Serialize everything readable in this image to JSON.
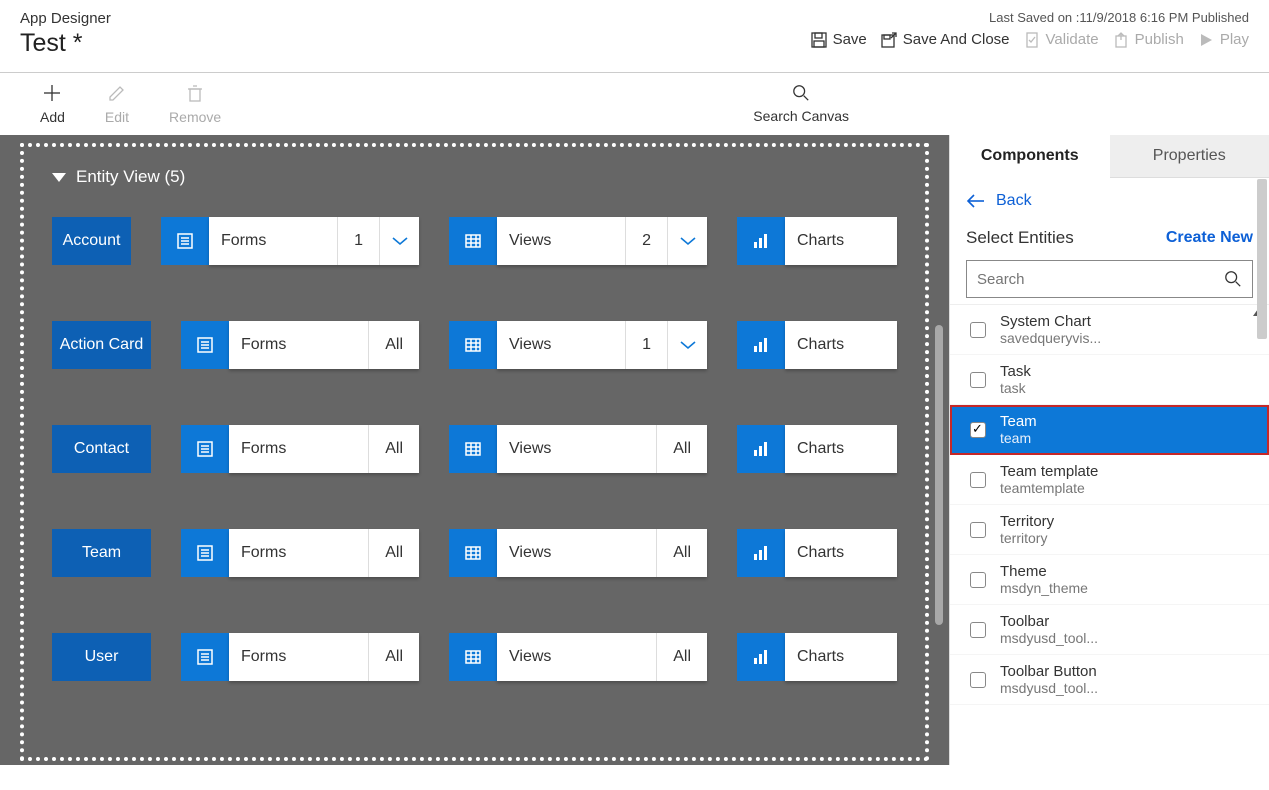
{
  "header": {
    "appLabel": "App Designer",
    "title": "Test *",
    "status": "Last Saved on :11/9/2018 6:16 PM Published",
    "actions": {
      "save": "Save",
      "saveClose": "Save And Close",
      "validate": "Validate",
      "publish": "Publish",
      "play": "Play"
    }
  },
  "toolbar": {
    "add": "Add",
    "edit": "Edit",
    "remove": "Remove",
    "searchCanvas": "Search Canvas"
  },
  "canvas": {
    "entityViewTitle": "Entity View (5)",
    "rows": [
      {
        "entity": "Account",
        "forms": {
          "label": "Forms",
          "count": "1",
          "chevron": true
        },
        "views": {
          "label": "Views",
          "count": "2",
          "chevron": true
        },
        "charts": {
          "label": "Charts"
        }
      },
      {
        "entity": "Action Card",
        "forms": {
          "label": "Forms",
          "count": "All",
          "chevron": false
        },
        "views": {
          "label": "Views",
          "count": "1",
          "chevron": true
        },
        "charts": {
          "label": "Charts"
        }
      },
      {
        "entity": "Contact",
        "forms": {
          "label": "Forms",
          "count": "All",
          "chevron": false
        },
        "views": {
          "label": "Views",
          "count": "All",
          "chevron": false
        },
        "charts": {
          "label": "Charts"
        }
      },
      {
        "entity": "Team",
        "forms": {
          "label": "Forms",
          "count": "All",
          "chevron": false
        },
        "views": {
          "label": "Views",
          "count": "All",
          "chevron": false
        },
        "charts": {
          "label": "Charts"
        }
      },
      {
        "entity": "User",
        "forms": {
          "label": "Forms",
          "count": "All",
          "chevron": false
        },
        "views": {
          "label": "Views",
          "count": "All",
          "chevron": false
        },
        "charts": {
          "label": "Charts"
        }
      }
    ]
  },
  "sidePanel": {
    "tabs": {
      "components": "Components",
      "properties": "Properties"
    },
    "back": "Back",
    "selectTitle": "Select Entities",
    "createNew": "Create New",
    "searchPlaceholder": "Search",
    "entities": [
      {
        "name": "System Chart",
        "sub": "savedqueryvis...",
        "checked": false
      },
      {
        "name": "Task",
        "sub": "task",
        "checked": false
      },
      {
        "name": "Team",
        "sub": "team",
        "checked": true
      },
      {
        "name": "Team template",
        "sub": "teamtemplate",
        "checked": false
      },
      {
        "name": "Territory",
        "sub": "territory",
        "checked": false
      },
      {
        "name": "Theme",
        "sub": "msdyn_theme",
        "checked": false
      },
      {
        "name": "Toolbar",
        "sub": "msdyusd_tool...",
        "checked": false
      },
      {
        "name": "Toolbar Button",
        "sub": "msdyusd_tool...",
        "checked": false
      }
    ]
  }
}
